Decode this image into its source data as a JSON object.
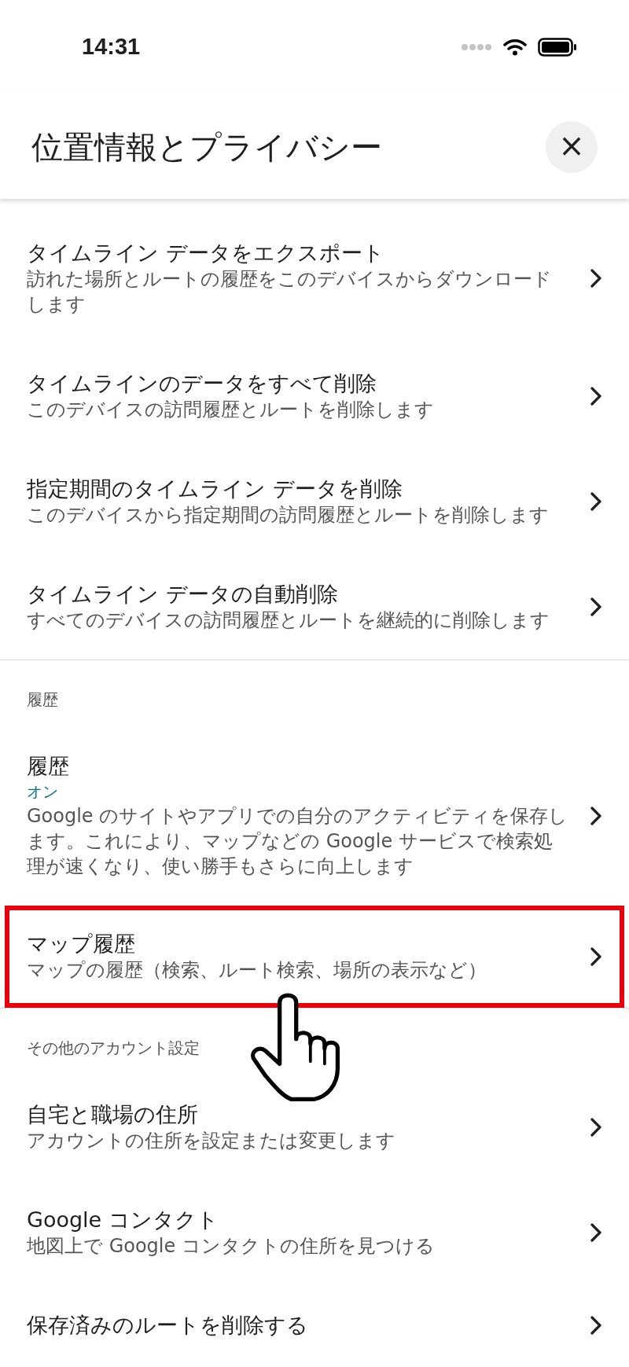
{
  "status_bar": {
    "time": "14:31"
  },
  "header": {
    "title": "位置情報とプライバシー",
    "close": "×"
  },
  "sections": [
    {
      "items": [
        {
          "title": "タイムライン データをエクスポート",
          "subtitle": "訪れた場所とルートの履歴をこのデバイスからダウンロードします",
          "highlighted": false
        },
        {
          "title": "タイムラインのデータをすべて削除",
          "subtitle": "このデバイスの訪問履歴とルートを削除します",
          "highlighted": false
        },
        {
          "title": "指定期間のタイムライン データを削除",
          "subtitle": "このデバイスから指定期間の訪問履歴とルートを削除します",
          "highlighted": false
        },
        {
          "title": "タイムライン データの自動削除",
          "subtitle": "すべてのデバイスの訪問履歴とルートを継続的に削除します",
          "highlighted": false
        }
      ]
    },
    {
      "heading": "履歴",
      "items": [
        {
          "title": "履歴",
          "status": "オン",
          "subtitle": "Google のサイトやアプリでの自分のアクティビティを保存します。これにより、マップなどの Google サービスで検索処理が速くなり、使い勝手もさらに向上します",
          "highlighted": false
        },
        {
          "title": "マップ履歴",
          "subtitle": "マップの履歴（検索、ルート検索、場所の表示など）",
          "highlighted": true
        }
      ]
    },
    {
      "heading": "その他のアカウント設定",
      "items": [
        {
          "title": "自宅と職場の住所",
          "subtitle": "アカウントの住所を設定または変更します",
          "highlighted": false
        },
        {
          "title": "Google コンタクト",
          "subtitle": "地図上で Google コンタクトの住所を見つける",
          "highlighted": false
        },
        {
          "title": "保存済みのルートを削除する",
          "highlighted": false
        }
      ]
    }
  ]
}
